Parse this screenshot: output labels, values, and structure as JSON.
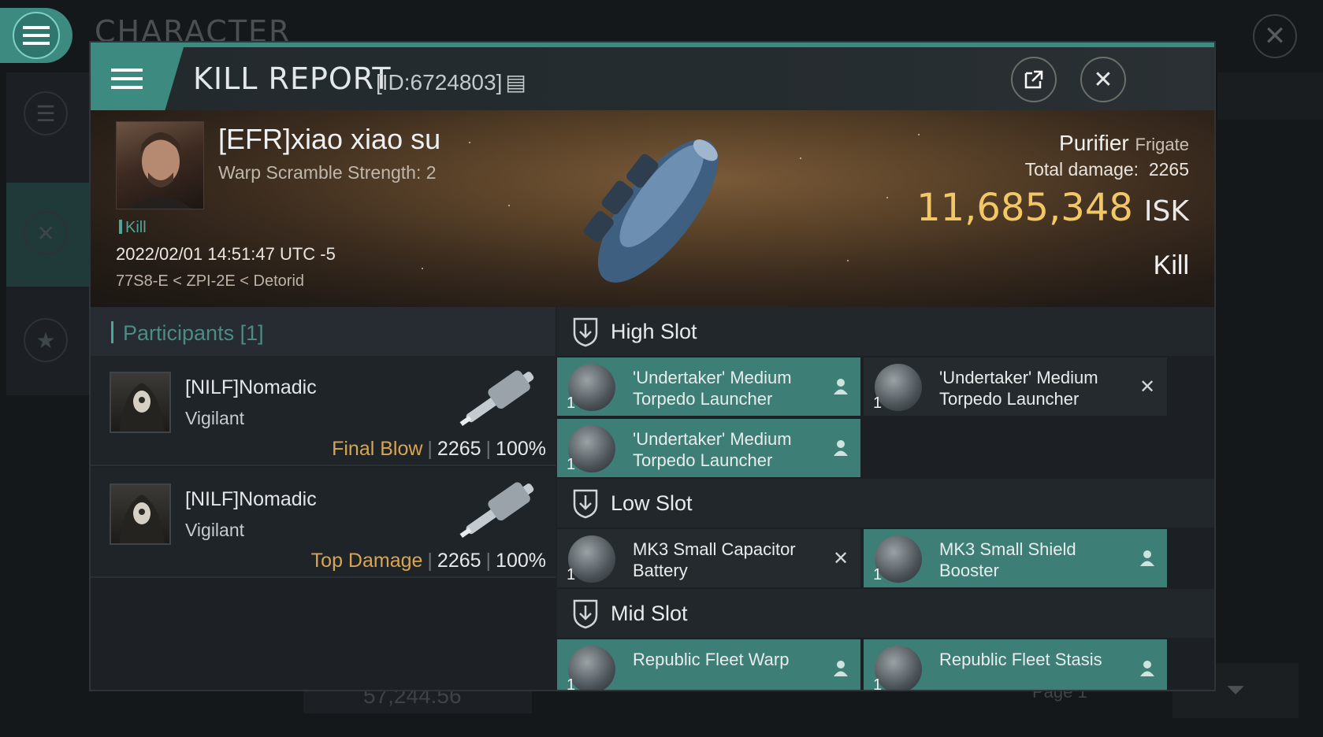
{
  "background": {
    "title": "CHARACTER",
    "bottom_value": "57,244.56",
    "page_label": "Page 1"
  },
  "header": {
    "title": "KILL REPORT",
    "report_id": "[ID:6724803]"
  },
  "victim": {
    "name": "[EFR]xiao xiao su",
    "subtitle": "Warp Scramble Strength: 2",
    "tag": "Kill",
    "timestamp": "2022/02/01 14:51:47 UTC -5",
    "location": "77S8-E < ZPI-2E < Detorid",
    "ship_name": "Purifier",
    "ship_class": "Frigate",
    "total_damage_label": "Total damage:",
    "total_damage": "2265",
    "isk_value": "11,685,348",
    "isk_unit": "ISK",
    "result": "Kill"
  },
  "participants": {
    "header": "Participants [1]",
    "rows": [
      {
        "name": "[NILF]Nomadic",
        "ship": "Vigilant",
        "role": "Final Blow",
        "damage": "2265",
        "percent": "100%"
      },
      {
        "name": "[NILF]Nomadic",
        "ship": "Vigilant",
        "role": "Top Damage",
        "damage": "2265",
        "percent": "100%"
      }
    ]
  },
  "fittings": {
    "high_slot_label": "High Slot",
    "low_slot_label": "Low Slot",
    "mid_slot_label": "Mid Slot",
    "high": [
      {
        "name": "'Undertaker' Medium Torpedo Launcher",
        "qty": "1",
        "status": "dropped"
      },
      {
        "name": "'Undertaker' Medium Torpedo Launcher",
        "qty": "1",
        "status": "destroyed"
      },
      {
        "name": "'Undertaker' Medium Torpedo Launcher",
        "qty": "1",
        "status": "dropped"
      }
    ],
    "low": [
      {
        "name": "MK3 Small Capacitor Battery",
        "qty": "1",
        "status": "destroyed"
      },
      {
        "name": "MK3 Small Shield Booster",
        "qty": "1",
        "status": "dropped"
      }
    ],
    "mid": [
      {
        "name": "Republic Fleet Warp",
        "qty": "1",
        "status": "dropped"
      },
      {
        "name": "Republic Fleet Stasis",
        "qty": "1",
        "status": "dropped"
      }
    ]
  },
  "colors": {
    "accent": "#3c8a80",
    "isk": "#f2c766",
    "role": "#d8a652"
  }
}
